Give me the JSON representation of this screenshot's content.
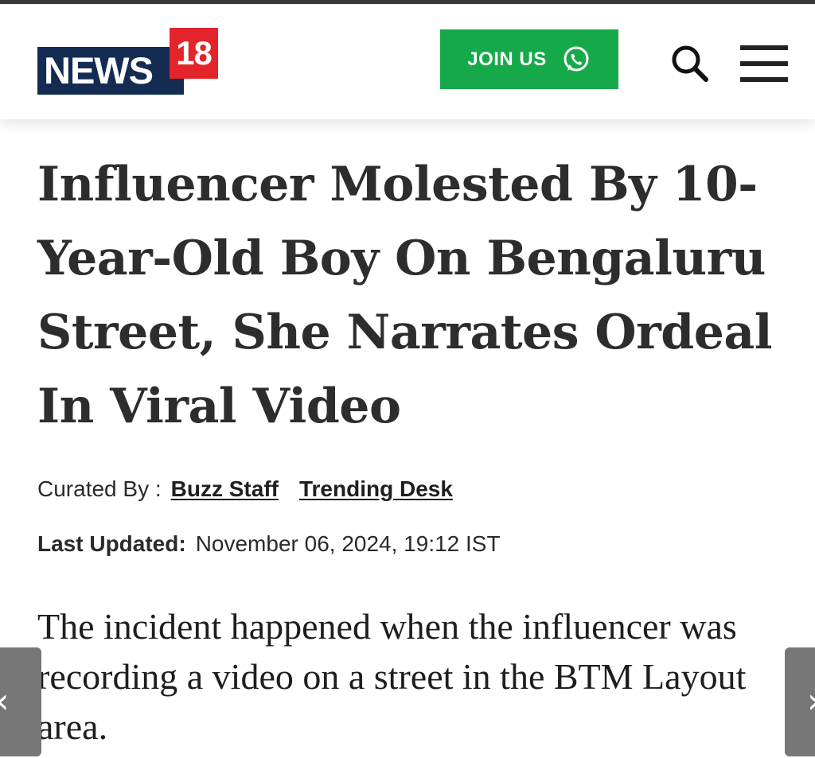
{
  "header": {
    "logo": {
      "word": "NEWS",
      "number": "18"
    },
    "join_button": {
      "label": "JOIN US",
      "icon": "whatsapp-icon"
    },
    "search_icon": "search-icon",
    "menu_icon": "hamburger-menu-icon"
  },
  "article": {
    "headline": "Influencer Molested By 10-Year-Old Boy On Bengaluru Street, She Narrates Ordeal In Viral Video",
    "byline": {
      "label": "Curated By :",
      "authors": [
        "Buzz Staff",
        "Trending Desk"
      ]
    },
    "last_updated": {
      "label": "Last Updated:",
      "value": "November 06, 2024, 19:12 IST"
    },
    "summary": "The incident happened when the influencer was recording a video on a street in the BTM Layout area."
  },
  "navigation": {
    "prev_icon": "chevron-left-icon",
    "next_icon": "chevron-right-icon"
  },
  "colors": {
    "logo_blue": "#142b52",
    "logo_red": "#e3242b",
    "join_green": "#16a94a",
    "arrow_gray": "#777777",
    "headline_text": "#2d2d2d"
  }
}
